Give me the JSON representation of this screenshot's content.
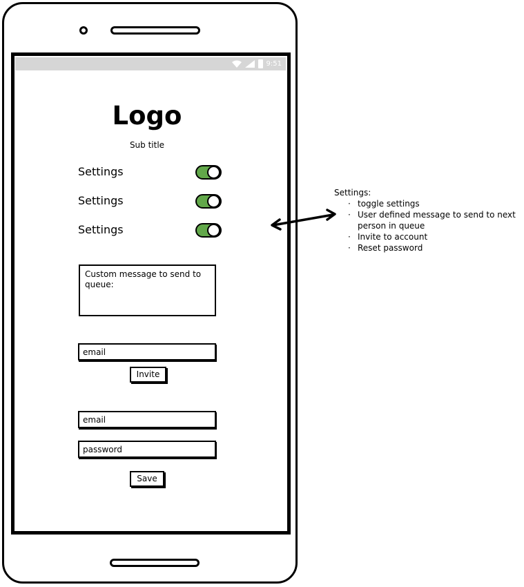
{
  "statusbar": {
    "time": "9:51",
    "icons": [
      "wifi-icon",
      "signal-icon",
      "battery-icon"
    ]
  },
  "app": {
    "logo": "Logo",
    "subtitle": "Sub title",
    "settings": [
      {
        "label": "Settings",
        "toggle_on": true
      },
      {
        "label": "Settings",
        "toggle_on": true
      },
      {
        "label": "Settings",
        "toggle_on": true
      }
    ],
    "custom_message": {
      "value": "Custom message to send to queue:"
    },
    "invite": {
      "email_placeholder": "email",
      "button_label": "Invite"
    },
    "account": {
      "email_placeholder": "email",
      "password_placeholder": "password",
      "save_label": "Save"
    }
  },
  "annotation": {
    "title": "Settings:",
    "items": [
      "toggle settings",
      "User defined message to send to next person in queue",
      "Invite to account",
      "Reset password"
    ]
  },
  "colors": {
    "toggle_on": "#62a84a",
    "statusbar": "#d6d6d6"
  }
}
